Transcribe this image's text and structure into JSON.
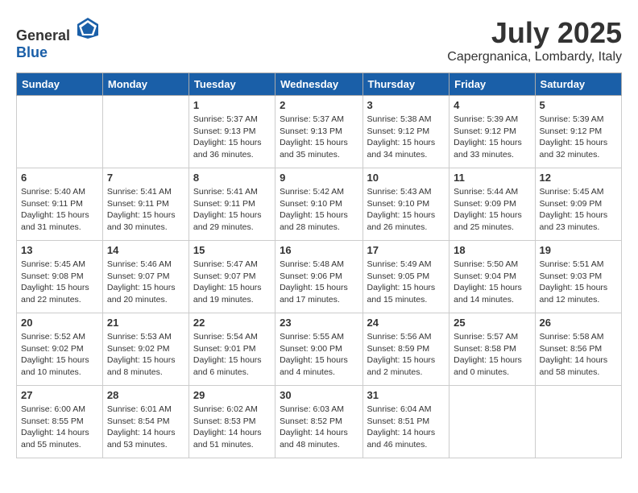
{
  "header": {
    "logo_general": "General",
    "logo_blue": "Blue",
    "month": "July 2025",
    "location": "Capergnanica, Lombardy, Italy"
  },
  "days_of_week": [
    "Sunday",
    "Monday",
    "Tuesday",
    "Wednesday",
    "Thursday",
    "Friday",
    "Saturday"
  ],
  "weeks": [
    [
      {
        "day": "",
        "info": ""
      },
      {
        "day": "",
        "info": ""
      },
      {
        "day": "1",
        "sunrise": "5:37 AM",
        "sunset": "9:13 PM",
        "daylight": "15 hours and 36 minutes."
      },
      {
        "day": "2",
        "sunrise": "5:37 AM",
        "sunset": "9:13 PM",
        "daylight": "15 hours and 35 minutes."
      },
      {
        "day": "3",
        "sunrise": "5:38 AM",
        "sunset": "9:12 PM",
        "daylight": "15 hours and 34 minutes."
      },
      {
        "day": "4",
        "sunrise": "5:39 AM",
        "sunset": "9:12 PM",
        "daylight": "15 hours and 33 minutes."
      },
      {
        "day": "5",
        "sunrise": "5:39 AM",
        "sunset": "9:12 PM",
        "daylight": "15 hours and 32 minutes."
      }
    ],
    [
      {
        "day": "6",
        "sunrise": "5:40 AM",
        "sunset": "9:11 PM",
        "daylight": "15 hours and 31 minutes."
      },
      {
        "day": "7",
        "sunrise": "5:41 AM",
        "sunset": "9:11 PM",
        "daylight": "15 hours and 30 minutes."
      },
      {
        "day": "8",
        "sunrise": "5:41 AM",
        "sunset": "9:11 PM",
        "daylight": "15 hours and 29 minutes."
      },
      {
        "day": "9",
        "sunrise": "5:42 AM",
        "sunset": "9:10 PM",
        "daylight": "15 hours and 28 minutes."
      },
      {
        "day": "10",
        "sunrise": "5:43 AM",
        "sunset": "9:10 PM",
        "daylight": "15 hours and 26 minutes."
      },
      {
        "day": "11",
        "sunrise": "5:44 AM",
        "sunset": "9:09 PM",
        "daylight": "15 hours and 25 minutes."
      },
      {
        "day": "12",
        "sunrise": "5:45 AM",
        "sunset": "9:09 PM",
        "daylight": "15 hours and 23 minutes."
      }
    ],
    [
      {
        "day": "13",
        "sunrise": "5:45 AM",
        "sunset": "9:08 PM",
        "daylight": "15 hours and 22 minutes."
      },
      {
        "day": "14",
        "sunrise": "5:46 AM",
        "sunset": "9:07 PM",
        "daylight": "15 hours and 20 minutes."
      },
      {
        "day": "15",
        "sunrise": "5:47 AM",
        "sunset": "9:07 PM",
        "daylight": "15 hours and 19 minutes."
      },
      {
        "day": "16",
        "sunrise": "5:48 AM",
        "sunset": "9:06 PM",
        "daylight": "15 hours and 17 minutes."
      },
      {
        "day": "17",
        "sunrise": "5:49 AM",
        "sunset": "9:05 PM",
        "daylight": "15 hours and 15 minutes."
      },
      {
        "day": "18",
        "sunrise": "5:50 AM",
        "sunset": "9:04 PM",
        "daylight": "15 hours and 14 minutes."
      },
      {
        "day": "19",
        "sunrise": "5:51 AM",
        "sunset": "9:03 PM",
        "daylight": "15 hours and 12 minutes."
      }
    ],
    [
      {
        "day": "20",
        "sunrise": "5:52 AM",
        "sunset": "9:02 PM",
        "daylight": "15 hours and 10 minutes."
      },
      {
        "day": "21",
        "sunrise": "5:53 AM",
        "sunset": "9:02 PM",
        "daylight": "15 hours and 8 minutes."
      },
      {
        "day": "22",
        "sunrise": "5:54 AM",
        "sunset": "9:01 PM",
        "daylight": "15 hours and 6 minutes."
      },
      {
        "day": "23",
        "sunrise": "5:55 AM",
        "sunset": "9:00 PM",
        "daylight": "15 hours and 4 minutes."
      },
      {
        "day": "24",
        "sunrise": "5:56 AM",
        "sunset": "8:59 PM",
        "daylight": "15 hours and 2 minutes."
      },
      {
        "day": "25",
        "sunrise": "5:57 AM",
        "sunset": "8:58 PM",
        "daylight": "15 hours and 0 minutes."
      },
      {
        "day": "26",
        "sunrise": "5:58 AM",
        "sunset": "8:56 PM",
        "daylight": "14 hours and 58 minutes."
      }
    ],
    [
      {
        "day": "27",
        "sunrise": "6:00 AM",
        "sunset": "8:55 PM",
        "daylight": "14 hours and 55 minutes."
      },
      {
        "day": "28",
        "sunrise": "6:01 AM",
        "sunset": "8:54 PM",
        "daylight": "14 hours and 53 minutes."
      },
      {
        "day": "29",
        "sunrise": "6:02 AM",
        "sunset": "8:53 PM",
        "daylight": "14 hours and 51 minutes."
      },
      {
        "day": "30",
        "sunrise": "6:03 AM",
        "sunset": "8:52 PM",
        "daylight": "14 hours and 48 minutes."
      },
      {
        "day": "31",
        "sunrise": "6:04 AM",
        "sunset": "8:51 PM",
        "daylight": "14 hours and 46 minutes."
      },
      {
        "day": "",
        "info": ""
      },
      {
        "day": "",
        "info": ""
      }
    ]
  ]
}
